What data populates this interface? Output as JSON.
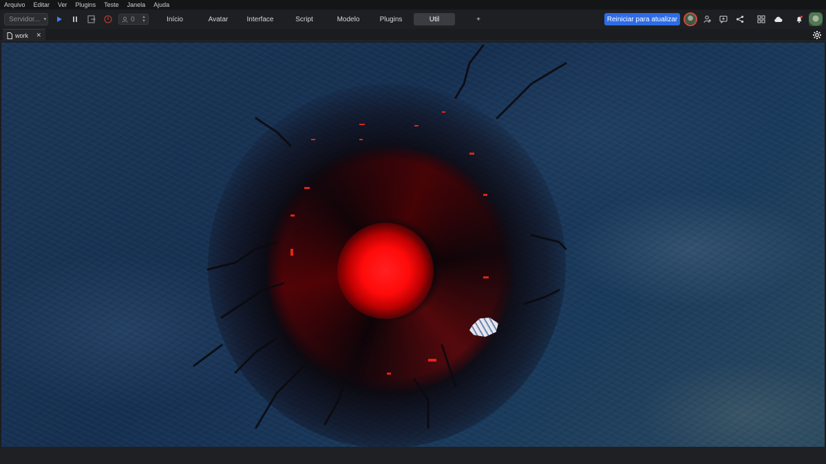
{
  "menu": [
    "Arquivo",
    "Editar",
    "Ver",
    "Plugins",
    "Teste",
    "Janela",
    "Ajuda"
  ],
  "toolbar": {
    "server_select": "Servidor...",
    "player_count": "0",
    "tabs": [
      "Início",
      "Avatar",
      "Interface",
      "Script",
      "Modelo",
      "Plugins",
      "Util",
      "+"
    ],
    "active_tab": "Util",
    "restart_label": "Reiniciar para atualizar"
  },
  "document_tab": {
    "label": "work"
  },
  "colors": {
    "accent": "#2d6ce6",
    "stop_red": "#d64a3a",
    "play_blue": "#3b82f6"
  },
  "icons": {
    "play": "play-icon",
    "pause": "pause-icon",
    "stop": "stop-icon",
    "exit": "exit-icon",
    "user": "user-icon",
    "share": "share-icon",
    "cloud": "cloud-icon",
    "bell": "bell-icon",
    "gear": "gear-icon"
  }
}
